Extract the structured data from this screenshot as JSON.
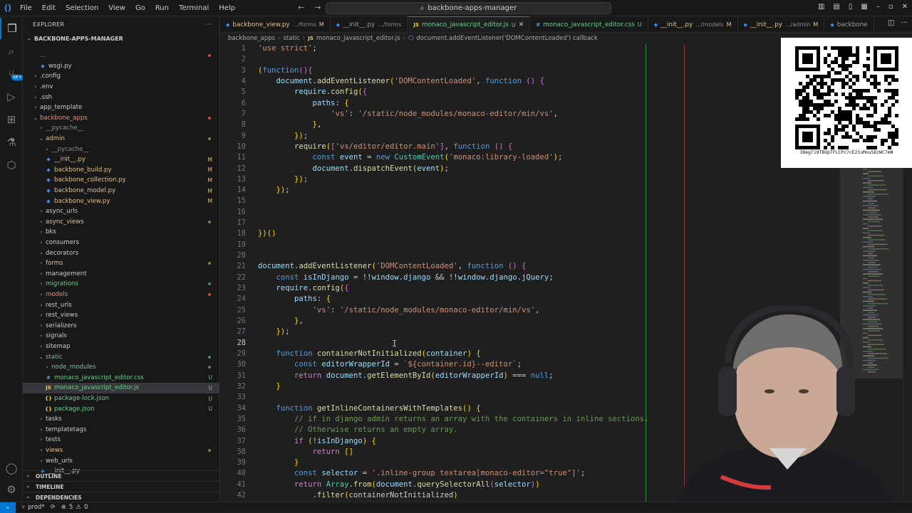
{
  "app": {
    "menu": [
      "File",
      "Edit",
      "Selection",
      "View",
      "Go",
      "Run",
      "Terminal",
      "Help"
    ],
    "search": "backbone-apps-manager"
  },
  "sidebar": {
    "title": "EXPLORER",
    "root": "BACKBONE-APPS-MANAGER",
    "tree": [
      {
        "name": "...",
        "indent": 1,
        "kind": "none",
        "color": "dim",
        "badge": "dot-err"
      },
      {
        "name": "wsgi.py",
        "indent": 2,
        "kind": "py",
        "color": "def",
        "badge": ""
      },
      {
        "name": ".config",
        "indent": 1,
        "kind": "folder",
        "color": "def",
        "badge": ""
      },
      {
        "name": ".env",
        "indent": 1,
        "kind": "folder",
        "color": "def",
        "badge": ""
      },
      {
        "name": ".ssh",
        "indent": 1,
        "kind": "folder",
        "color": "def",
        "badge": ""
      },
      {
        "name": "app_template",
        "indent": 1,
        "kind": "folder",
        "color": "def",
        "badge": ""
      },
      {
        "name": "backbone_apps",
        "indent": 1,
        "kind": "folder-open",
        "color": "err",
        "badge": "dot-err"
      },
      {
        "name": "__pycache__",
        "indent": 2,
        "kind": "folder",
        "color": "dim",
        "badge": ""
      },
      {
        "name": "admin",
        "indent": 2,
        "kind": "folder-open",
        "color": "mod",
        "badge": "dot-mod"
      },
      {
        "name": "__pycache__",
        "indent": 3,
        "kind": "folder",
        "color": "dim",
        "badge": ""
      },
      {
        "name": "__init__.py",
        "indent": 3,
        "kind": "py",
        "color": "mod",
        "badge": "M"
      },
      {
        "name": "backbone_build.py",
        "indent": 3,
        "kind": "py",
        "color": "mod",
        "badge": "M"
      },
      {
        "name": "backbone_collection.py",
        "indent": 3,
        "kind": "py",
        "color": "mod",
        "badge": "M"
      },
      {
        "name": "backbone_model.py",
        "indent": 3,
        "kind": "py",
        "color": "mod",
        "badge": "M"
      },
      {
        "name": "backbone_view.py",
        "indent": 3,
        "kind": "py",
        "color": "mod",
        "badge": "M"
      },
      {
        "name": "async_urls",
        "indent": 2,
        "kind": "folder",
        "color": "def",
        "badge": ""
      },
      {
        "name": "async_views",
        "indent": 2,
        "kind": "folder",
        "color": "mod",
        "badge": "dot-mod"
      },
      {
        "name": "bks",
        "indent": 2,
        "kind": "folder",
        "color": "def",
        "badge": ""
      },
      {
        "name": "consumers",
        "indent": 2,
        "kind": "folder",
        "color": "def",
        "badge": ""
      },
      {
        "name": "decorators",
        "indent": 2,
        "kind": "folder",
        "color": "def",
        "badge": ""
      },
      {
        "name": "forms",
        "indent": 2,
        "kind": "folder",
        "color": "mod",
        "badge": "dot-mod"
      },
      {
        "name": "management",
        "indent": 2,
        "kind": "folder",
        "color": "def",
        "badge": ""
      },
      {
        "name": "migrations",
        "indent": 2,
        "kind": "folder",
        "color": "unt",
        "badge": "dot-unt"
      },
      {
        "name": "models",
        "indent": 2,
        "kind": "folder",
        "color": "err",
        "badge": "dot-err"
      },
      {
        "name": "rest_urls",
        "indent": 2,
        "kind": "folder",
        "color": "def",
        "badge": ""
      },
      {
        "name": "rest_views",
        "indent": 2,
        "kind": "folder",
        "color": "def",
        "badge": ""
      },
      {
        "name": "serializers",
        "indent": 2,
        "kind": "folder",
        "color": "def",
        "badge": ""
      },
      {
        "name": "signals",
        "indent": 2,
        "kind": "folder",
        "color": "def",
        "badge": ""
      },
      {
        "name": "sitemap",
        "indent": 2,
        "kind": "folder",
        "color": "def",
        "badge": ""
      },
      {
        "name": "static",
        "indent": 2,
        "kind": "folder-open",
        "color": "unt",
        "badge": "dot-unt"
      },
      {
        "name": "node_modules",
        "indent": 3,
        "kind": "folder",
        "color": "unt",
        "badge": "dot-unt"
      },
      {
        "name": "monaco_javascript_editor.css",
        "indent": 3,
        "kind": "css",
        "color": "unt",
        "badge": "U"
      },
      {
        "name": "monaco_javascript_editor.js",
        "indent": 3,
        "kind": "js",
        "color": "unt",
        "badge": "U",
        "selected": true
      },
      {
        "name": "package-lock.json",
        "indent": 3,
        "kind": "json",
        "color": "unt",
        "badge": "U"
      },
      {
        "name": "package.json",
        "indent": 3,
        "kind": "json",
        "color": "unt",
        "badge": "U"
      },
      {
        "name": "tasks",
        "indent": 2,
        "kind": "folder",
        "color": "def",
        "badge": ""
      },
      {
        "name": "templatetags",
        "indent": 2,
        "kind": "folder",
        "color": "def",
        "badge": ""
      },
      {
        "name": "tests",
        "indent": 2,
        "kind": "folder",
        "color": "def",
        "badge": ""
      },
      {
        "name": "views",
        "indent": 2,
        "kind": "folder",
        "color": "mod",
        "badge": "dot-mod"
      },
      {
        "name": "web_urls",
        "indent": 2,
        "kind": "folder",
        "color": "def",
        "badge": ""
      },
      {
        "name": "__init__.py",
        "indent": 2,
        "kind": "py",
        "color": "def",
        "badge": ""
      }
    ],
    "sections": [
      "OUTLINE",
      "TIMELINE",
      "DEPENDENCIES"
    ]
  },
  "tabs": [
    {
      "name": "backbone_view.py",
      "desc": ".../forms",
      "status": "M",
      "kind": "py",
      "active": false
    },
    {
      "name": "__init__.py",
      "desc": ".../forms",
      "status": "",
      "kind": "py",
      "active": false
    },
    {
      "name": "monaco_javascript_editor.js",
      "desc": "",
      "status": "U",
      "kind": "js",
      "active": true
    },
    {
      "name": "monaco_javascript_editor.css",
      "desc": "",
      "status": "U",
      "kind": "css",
      "active": false
    },
    {
      "name": "__init__.py",
      "desc": ".../models",
      "status": "M",
      "kind": "py",
      "active": false
    },
    {
      "name": "__init__.py",
      "desc": ".../admin",
      "status": "M",
      "kind": "py",
      "active": false
    },
    {
      "name": "backbone",
      "desc": "",
      "status": "",
      "kind": "py",
      "active": false
    }
  ],
  "breadcrumb": [
    "backbone_apps",
    "static",
    "monaco_javascript_editor.js",
    "document.addEventListener('DOMContentLoaded') callback"
  ],
  "editor": {
    "current_line": 28,
    "lines": [
      [
        1,
        "'use strict';"
      ],
      [
        2,
        ""
      ],
      [
        3,
        "(function(){"
      ],
      [
        4,
        "    document.addEventListener('DOMContentLoaded', function () {"
      ],
      [
        5,
        "        require.config({"
      ],
      [
        6,
        "            paths: {"
      ],
      [
        7,
        "                'vs': '/static/node_modules/monaco-editor/min/vs',"
      ],
      [
        8,
        "            },"
      ],
      [
        9,
        "        });"
      ],
      [
        10,
        "        require(['vs/editor/editor.main'], function () {"
      ],
      [
        11,
        "            const event = new CustomEvent('monaco:library-loaded');"
      ],
      [
        12,
        "            document.dispatchEvent(event);"
      ],
      [
        13,
        "        });"
      ],
      [
        14,
        "    });"
      ],
      [
        15,
        ""
      ],
      [
        16,
        ""
      ],
      [
        17,
        ""
      ],
      [
        18,
        "})()"
      ],
      [
        19,
        ""
      ],
      [
        20,
        ""
      ],
      [
        21,
        "document.addEventListener('DOMContentLoaded', function () {"
      ],
      [
        22,
        "    const isInDjango = !!window.django && !!window.django.jQuery;"
      ],
      [
        23,
        "    require.config({"
      ],
      [
        24,
        "        paths: {"
      ],
      [
        25,
        "            'vs': '/static/node_modules/monaco-editor/min/vs',"
      ],
      [
        26,
        "        },"
      ],
      [
        27,
        "    });"
      ],
      [
        28,
        ""
      ],
      [
        29,
        "    function containerNotInitialized(container) {"
      ],
      [
        30,
        "        const editorWrapperId = `${container.id}--editor`;"
      ],
      [
        31,
        "        return document.getElementById(editorWrapperId) === null;"
      ],
      [
        32,
        "    }"
      ],
      [
        33,
        ""
      ],
      [
        34,
        "    function getInlineContainersWithTemplates() {"
      ],
      [
        35,
        "        // if in django admin returns an array with the containers in inline sections."
      ],
      [
        36,
        "        // Otherwise returns an empty array."
      ],
      [
        37,
        "        if (!isInDjango) {"
      ],
      [
        38,
        "            return []"
      ],
      [
        39,
        "        }"
      ],
      [
        40,
        "        const selector = '.inline-group textarea[monaco-editor=\"true\"]';"
      ],
      [
        41,
        "        return Array.from(document.querySelectorAll(selector))"
      ],
      [
        42,
        "            .filter(containerNotInitialized)"
      ]
    ]
  },
  "qr": {
    "caption": "38egT19TBUpTFLCPc7cE21uMou5DzWC7mN"
  },
  "status": {
    "branch": "prod*",
    "problems": "5",
    "warnings": "0"
  }
}
